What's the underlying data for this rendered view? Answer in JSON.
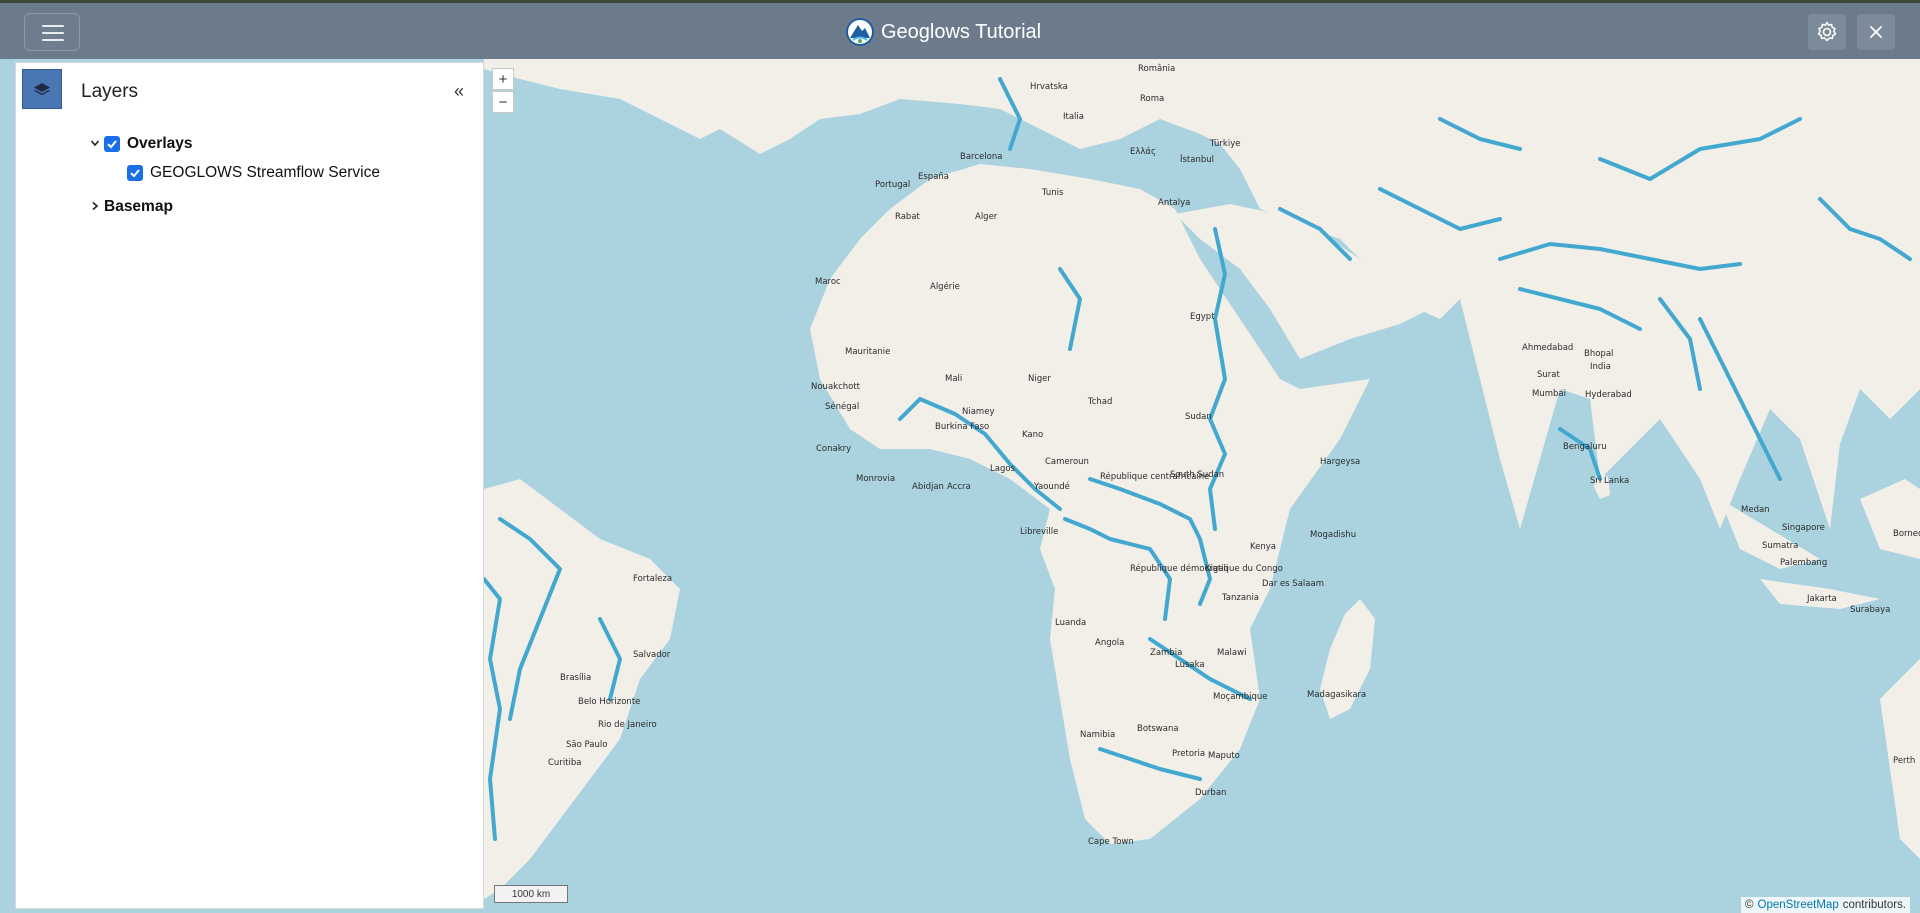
{
  "header": {
    "title": "Geoglows Tutorial",
    "icons": {
      "menu": "hamburger-icon",
      "settings": "gear-icon",
      "close": "close-icon"
    }
  },
  "layers_panel": {
    "title": "Layers",
    "collapse_label": "«",
    "items": [
      {
        "label": "Overlays",
        "checked": true,
        "expanded": true
      },
      {
        "label": "GEOGLOWS Streamflow Service",
        "checked": true
      },
      {
        "label": "Basemap",
        "expanded": false
      }
    ]
  },
  "map": {
    "zoom_in": "+",
    "zoom_out": "−",
    "scale_label": "1000 km",
    "attribution_prefix": "©",
    "attribution_link": "OpenStreetMap",
    "attribution_suffix": "contributors.",
    "place_labels": [
      "Barcelona",
      "Roma",
      "İstanbul",
      "Antalya",
      "España",
      "Portugal",
      "Rabat",
      "Alger",
      "Tunis",
      "Algérie",
      "Maroc",
      "Mauritanie",
      "Nouakchott",
      "Sénégal",
      "Niger",
      "Mali",
      "Tchad",
      "Niamey",
      "Burkina Faso",
      "Conakry",
      "Monrovia",
      "Abidjan",
      "Accra",
      "Lagos",
      "Kano",
      "Yaoundé",
      "Libreville",
      "Cameroun",
      "République centrafricaine",
      "South Sudan",
      "Sudan",
      "Egypt",
      "Hargeysa",
      "Mogadishu",
      "Kenya",
      "Tanzania",
      "Dar es Salaam",
      "Kigali",
      "République démocratique du Congo",
      "Luanda",
      "Angola",
      "Zambia",
      "Lusaka",
      "Malawi",
      "Moçambique",
      "Madagasikara",
      "Namibia",
      "Botswana",
      "Pretoria",
      "Maputo",
      "Durban",
      "Cape Town",
      "Fortaleza",
      "Salvador",
      "Brasília",
      "Belo Horizonte",
      "Rio de Janeiro",
      "São Paulo",
      "Curitiba",
      "Ahmedabad",
      "Surat",
      "Mumbai",
      "Bhopal",
      "India",
      "Hyderabad",
      "Bengaluru",
      "Sri Lanka",
      "Medan",
      "Singapore",
      "Sumatra",
      "Palembang",
      "Jakarta",
      "Surabaya",
      "Borneo",
      "Perth",
      "Türkiye",
      "Hrvatska",
      "Italia",
      "Ελλάς",
      "România"
    ]
  },
  "colors": {
    "header": "#6b7b8c",
    "water": "#aad3df",
    "land": "#f2efe9",
    "river": "#42a8cf",
    "accent": "#1a6fe8",
    "layer_icon": "#4a76b4"
  }
}
